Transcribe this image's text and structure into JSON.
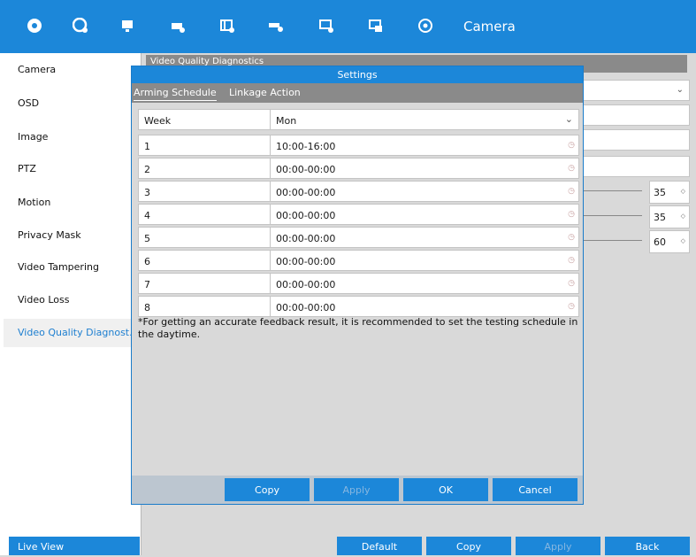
{
  "topbar": {
    "title": "Camera",
    "icons": [
      "camera-settings-icon",
      "record-icon",
      "network-icon",
      "alarm-icon",
      "storage-icon",
      "maintenance-icon",
      "monitor-icon",
      "system-icon",
      "target-icon"
    ]
  },
  "sidebar": {
    "items": [
      {
        "label": "Camera"
      },
      {
        "label": "OSD"
      },
      {
        "label": "Image"
      },
      {
        "label": "PTZ"
      },
      {
        "label": "Motion"
      },
      {
        "label": "Privacy Mask"
      },
      {
        "label": "Video Tampering"
      },
      {
        "label": "Video Loss"
      },
      {
        "label": "Video Quality Diagnost..."
      }
    ],
    "live_view": "Live View"
  },
  "background": {
    "header_title": "Video Quality Diagnostics",
    "values": [
      "35",
      "35",
      "60"
    ]
  },
  "bottom_buttons": {
    "default": "Default",
    "copy": "Copy",
    "apply": "Apply",
    "back": "Back"
  },
  "dialog": {
    "title": "Settings",
    "tabs": [
      "Arming Schedule",
      "Linkage Action"
    ],
    "week_label": "Week",
    "week_value": "Mon",
    "schedule": [
      {
        "num": "1",
        "time": "10:00-16:00"
      },
      {
        "num": "2",
        "time": "00:00-00:00"
      },
      {
        "num": "3",
        "time": "00:00-00:00"
      },
      {
        "num": "4",
        "time": "00:00-00:00"
      },
      {
        "num": "5",
        "time": "00:00-00:00"
      },
      {
        "num": "6",
        "time": "00:00-00:00"
      },
      {
        "num": "7",
        "time": "00:00-00:00"
      },
      {
        "num": "8",
        "time": "00:00-00:00"
      }
    ],
    "note": "*For getting an accurate feedback result, it is recommended to set the testing schedule in the daytime.",
    "buttons": {
      "copy": "Copy",
      "apply": "Apply",
      "ok": "OK",
      "cancel": "Cancel"
    }
  },
  "colors": {
    "accent": "#1c87d9",
    "active_text": "#1e7fd0",
    "panel": "#d9d9d9"
  }
}
